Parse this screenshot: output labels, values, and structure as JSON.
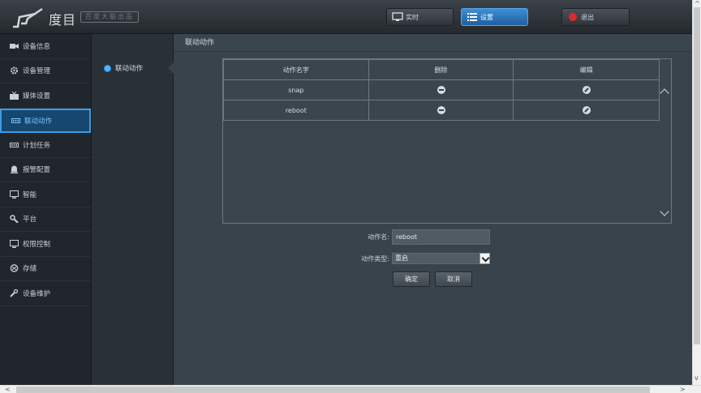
{
  "header": {
    "logo_text": "度目",
    "logo_badge": "百度大脑出品",
    "buttons": [
      {
        "label": "实时",
        "icon": "monitor-icon",
        "active": false
      },
      {
        "label": "设置",
        "icon": "list-icon",
        "active": true
      },
      {
        "label": "退出",
        "icon": "power-icon",
        "active": false
      }
    ]
  },
  "sidebar": {
    "items": [
      {
        "label": "设备信息",
        "icon": "camera-icon"
      },
      {
        "label": "设备管理",
        "icon": "gear-icon"
      },
      {
        "label": "媒体设置",
        "icon": "media-icon"
      },
      {
        "label": "联动动作",
        "icon": "link-action-icon",
        "active": true
      },
      {
        "label": "计划任务",
        "icon": "schedule-icon"
      },
      {
        "label": "报警配置",
        "icon": "alarm-icon"
      },
      {
        "label": "智能",
        "icon": "monitor-icon"
      },
      {
        "label": "平台",
        "icon": "wrench-icon"
      },
      {
        "label": "权限控制",
        "icon": "monitor-icon"
      },
      {
        "label": "存储",
        "icon": "storage-icon"
      },
      {
        "label": "设备维护",
        "icon": "tool-icon"
      }
    ]
  },
  "subnav": {
    "items": [
      {
        "label": "联动动作"
      }
    ]
  },
  "main": {
    "title": "联动动作",
    "table": {
      "headers": [
        "动作名字",
        "删除",
        "编辑"
      ],
      "rows": [
        {
          "name": "snap"
        },
        {
          "name": "reboot"
        }
      ]
    },
    "form": {
      "name_label": "动作名:",
      "name_value": "reboot",
      "type_label": "动作类型:",
      "type_value": "重启",
      "confirm_label": "确定",
      "cancel_label": "取消"
    }
  },
  "colors": {
    "accent": "#3a9ce6",
    "background": "#38434b",
    "sidebar": "#20262b"
  }
}
